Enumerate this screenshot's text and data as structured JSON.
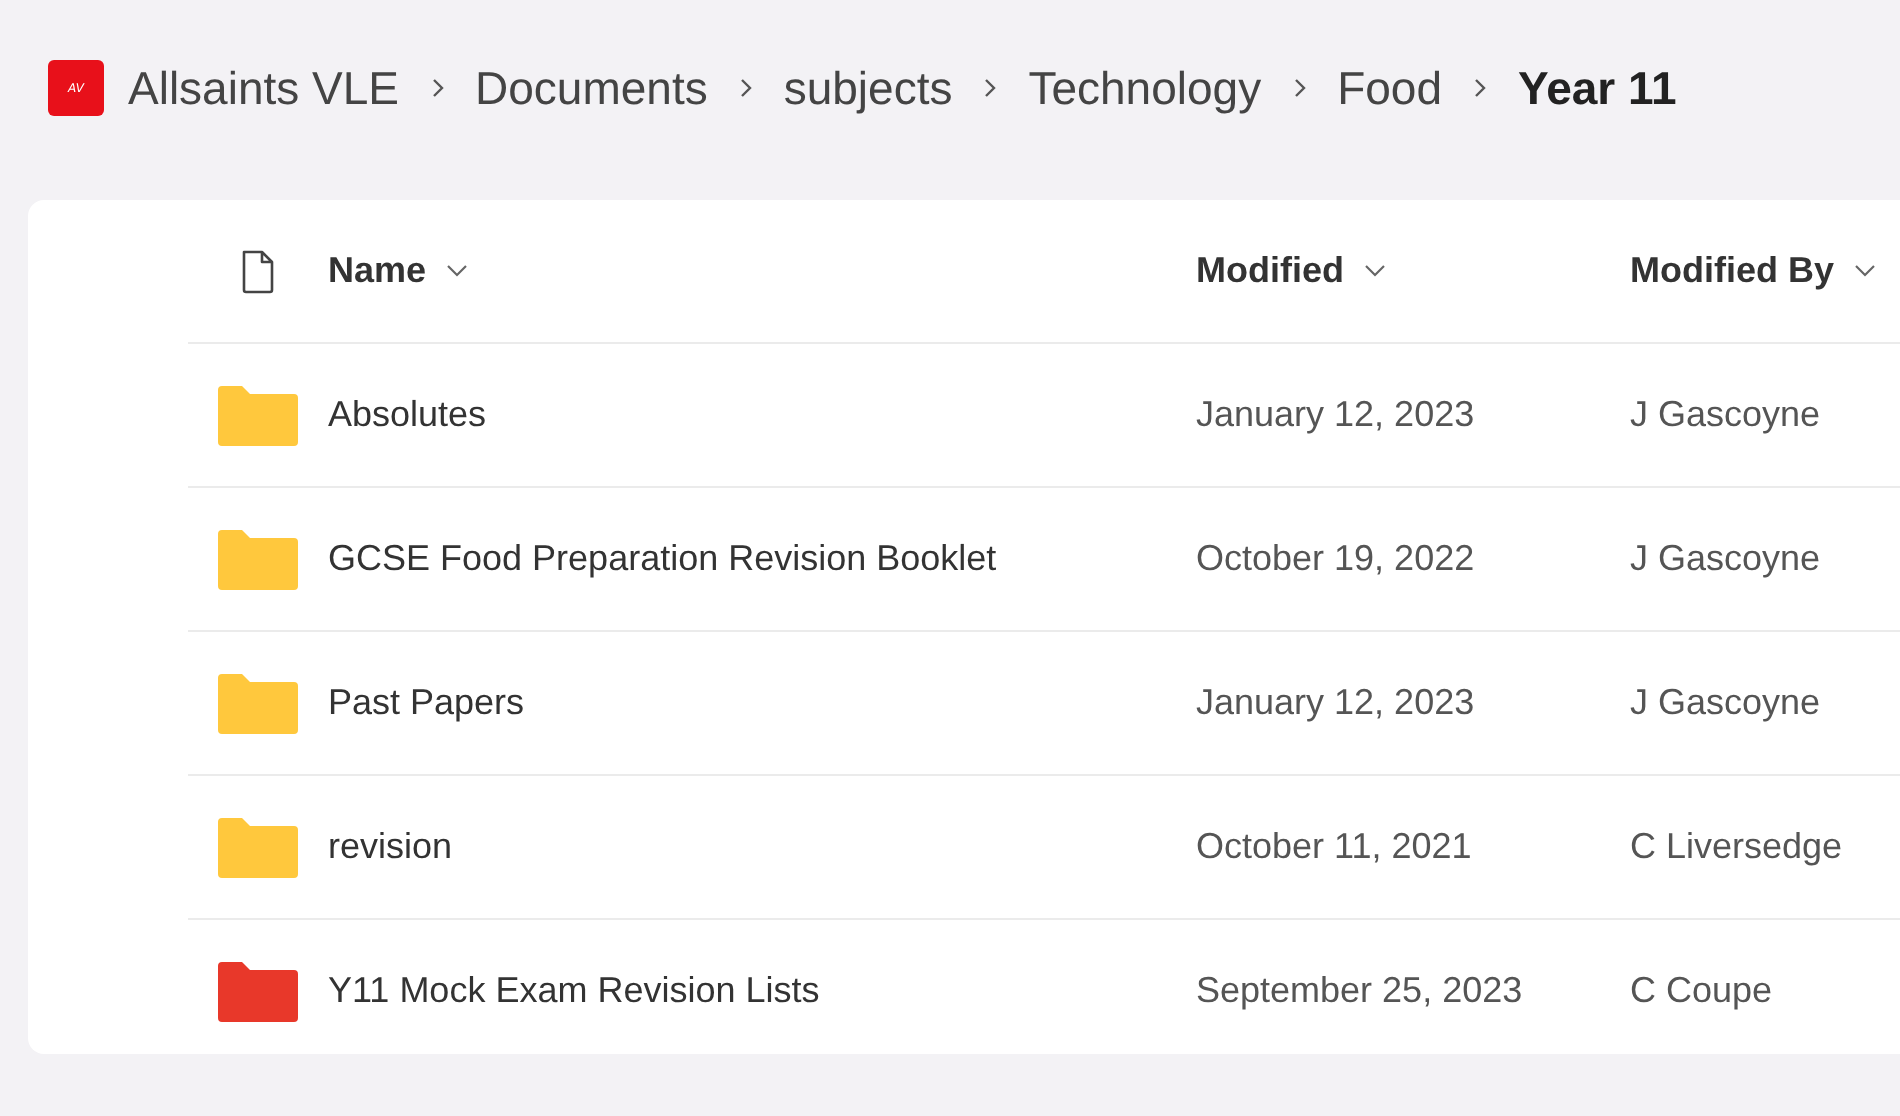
{
  "breadcrumb": {
    "logo_text": "AV",
    "items": [
      {
        "label": "Allsaints VLE",
        "selected": false
      },
      {
        "label": "Documents",
        "selected": false
      },
      {
        "label": "subjects",
        "selected": false
      },
      {
        "label": "Technology",
        "selected": false
      },
      {
        "label": "Food",
        "selected": false
      },
      {
        "label": "Year 11",
        "selected": true
      }
    ]
  },
  "table": {
    "columns": [
      "Name",
      "Modified",
      "Modified By"
    ],
    "rows": [
      {
        "name": "Absolutes",
        "modified": "January 12, 2023",
        "modified_by": "J Gascoyne",
        "color": "#ffc83d"
      },
      {
        "name": "GCSE Food Preparation Revision Booklet",
        "modified": "October 19, 2022",
        "modified_by": "J Gascoyne",
        "color": "#ffc83d"
      },
      {
        "name": "Past Papers",
        "modified": "January 12, 2023",
        "modified_by": "J Gascoyne",
        "color": "#ffc83d"
      },
      {
        "name": "revision",
        "modified": "October 11, 2021",
        "modified_by": "C Liversedge",
        "color": "#ffc83d"
      },
      {
        "name": "Y11 Mock Exam Revision Lists",
        "modified": "September 25, 2023",
        "modified_by": "C Coupe",
        "color": "#e8382a"
      }
    ]
  }
}
